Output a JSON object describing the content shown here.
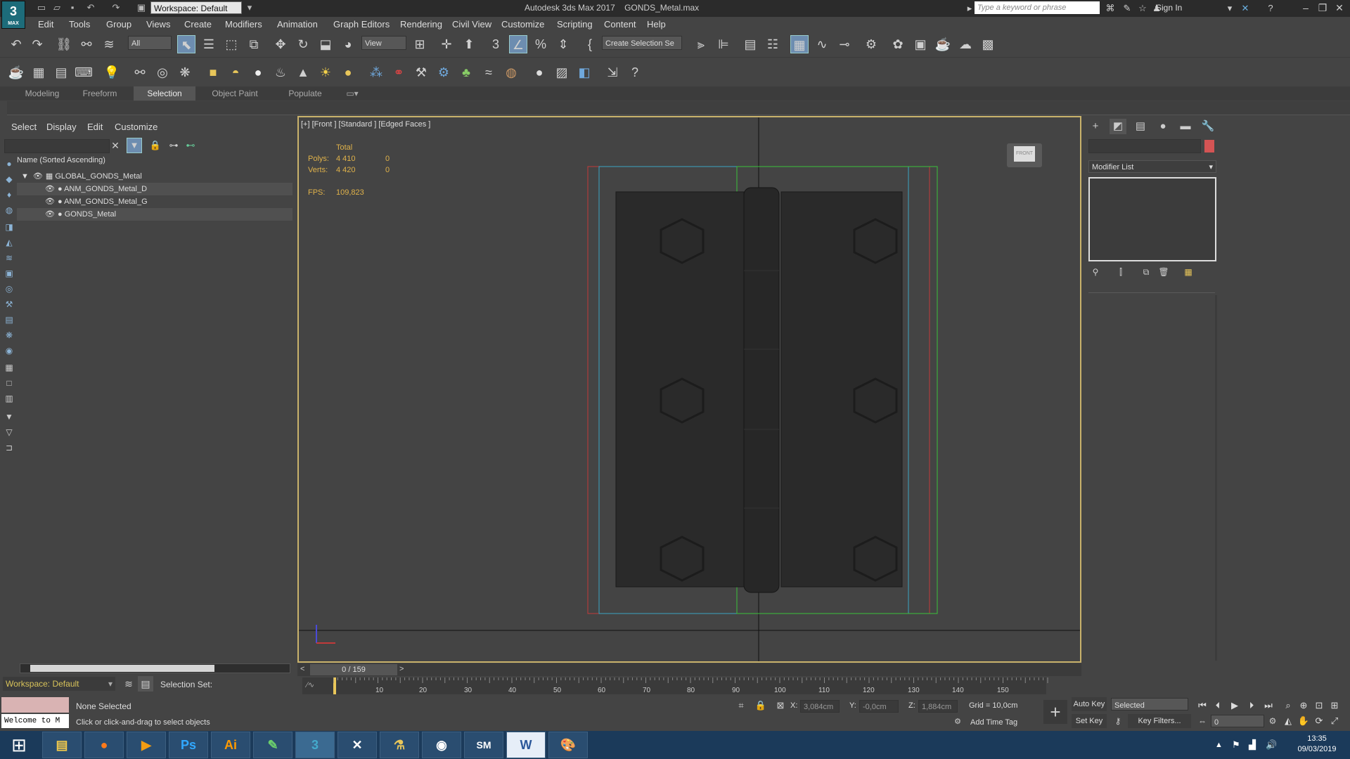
{
  "title_bar": {
    "logo_main": "3",
    "logo_sub": "MAX",
    "workspace": "Workspace: Default",
    "app_name": "Autodesk 3ds Max 2017",
    "file_name": "GONDS_Metal.max",
    "search_placeholder": "Type a keyword or phrase",
    "sign_in": "Sign In"
  },
  "menu": [
    "Edit",
    "Tools",
    "Group",
    "Views",
    "Create",
    "Modifiers",
    "Animation",
    "Graph Editors",
    "Rendering",
    "Civil View",
    "Customize",
    "Scripting",
    "Content",
    "Help"
  ],
  "toolbar": {
    "filter": "All",
    "ref_coord": "View",
    "create_selection_set": "Create Selection Se"
  },
  "ribbon_tabs": [
    "Modeling",
    "Freeform",
    "Selection",
    "Object Paint",
    "Populate"
  ],
  "scene_explorer": {
    "tabs": [
      "Select",
      "Display",
      "Edit",
      "Customize"
    ],
    "column_header": "Name (Sorted Ascending)",
    "rows": [
      "GLOBAL_GONDS_Metal",
      "ANM_GONDS_Metal_D",
      "ANM_GONDS_Metal_G",
      "GONDS_Metal"
    ]
  },
  "viewport": {
    "label": "[+] [Front ] [Standard ] [Edged Faces ]",
    "stats": {
      "total_label": "Total",
      "polys_label": "Polys:",
      "polys_total": "4 410",
      "polys_sel": "0",
      "verts_label": "Verts:",
      "verts_total": "4 420",
      "verts_sel": "0",
      "fps_label": "FPS:",
      "fps": "109,823"
    },
    "viewcube_label": "FRONT"
  },
  "command_panel": {
    "modifier_list": "Modifier List"
  },
  "timeline": {
    "frame": "0 / 159",
    "ticks": [
      "10",
      "20",
      "30",
      "40",
      "50",
      "60",
      "70",
      "80",
      "90",
      "100",
      "110",
      "120",
      "130",
      "140",
      "150"
    ]
  },
  "status": {
    "workspace": "Workspace: Default",
    "selection_set": "Selection Set:",
    "welcome": "Welcome to M",
    "none_selected": "None Selected",
    "prompt": "Click or click-and-drag to select objects",
    "x_label": "X:",
    "x_value": "3,084cm",
    "y_label": "Y:",
    "y_value": "-0,0cm",
    "z_label": "Z:",
    "z_value": "1,884cm",
    "grid": "Grid = 10,0cm",
    "add_time_tag": "Add Time Tag",
    "auto_key": "Auto Key",
    "set_key": "Set Key",
    "key_mode": "Selected",
    "key_filters": "Key Filters...",
    "frame_value": "0"
  },
  "taskbar": {
    "apps": [
      "explorer",
      "firefox",
      "media-player",
      "Ps",
      "Ai",
      "sketch",
      "3dsmax",
      "zbrush",
      "flask",
      "maya",
      "SM",
      "W",
      "paint"
    ],
    "time": "13:35",
    "date": "09/03/2019"
  },
  "colors": {
    "viewport_border": "#c9b26b",
    "stats_text": "#e0b24a",
    "object_color": "#d45454"
  }
}
